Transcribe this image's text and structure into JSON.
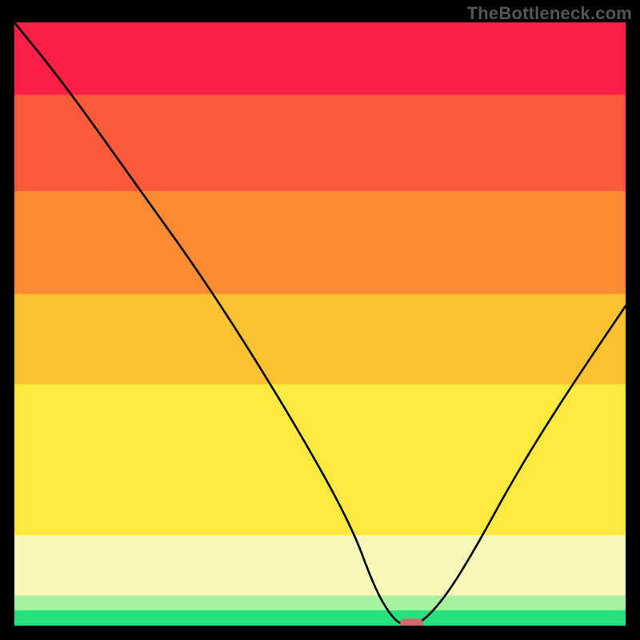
{
  "watermark": "TheBottleneck.com",
  "chart_data": {
    "type": "line",
    "title": "",
    "xlabel": "",
    "ylabel": "",
    "xlim": [
      0,
      100
    ],
    "ylim": [
      0,
      100
    ],
    "background_bands": [
      {
        "name": "green",
        "color": "#27e07e",
        "y_from": 0,
        "y_to": 2.5
      },
      {
        "name": "pale-green",
        "color": "#a6f2a0",
        "y_from": 2.5,
        "y_to": 5
      },
      {
        "name": "cream",
        "color": "#f6f7b9",
        "y_from": 5,
        "y_to": 15
      },
      {
        "name": "yellow",
        "color": "#fde940",
        "y_from": 15,
        "y_to": 40
      },
      {
        "name": "gold",
        "color": "#fec132",
        "y_from": 40,
        "y_to": 55
      },
      {
        "name": "orange",
        "color": "#fc8b34",
        "y_from": 55,
        "y_to": 72
      },
      {
        "name": "red-orange",
        "color": "#fb5a3b",
        "y_from": 72,
        "y_to": 88
      },
      {
        "name": "red",
        "color": "#fa1f46",
        "y_from": 88,
        "y_to": 100
      }
    ],
    "series": [
      {
        "name": "bottleneck-curve",
        "color": "#000000",
        "x": [
          0,
          8,
          20,
          32,
          45,
          55,
          59,
          62,
          64,
          66,
          70,
          75,
          82,
          90,
          100
        ],
        "y": [
          100,
          90,
          73,
          56,
          35,
          17,
          6,
          1,
          0,
          0,
          4,
          12,
          25,
          38,
          53
        ]
      }
    ],
    "marker": {
      "name": "optimal-point",
      "x": 65,
      "y": 0,
      "color": "#d06a6b",
      "width": 3.8,
      "height": 1.8
    }
  }
}
